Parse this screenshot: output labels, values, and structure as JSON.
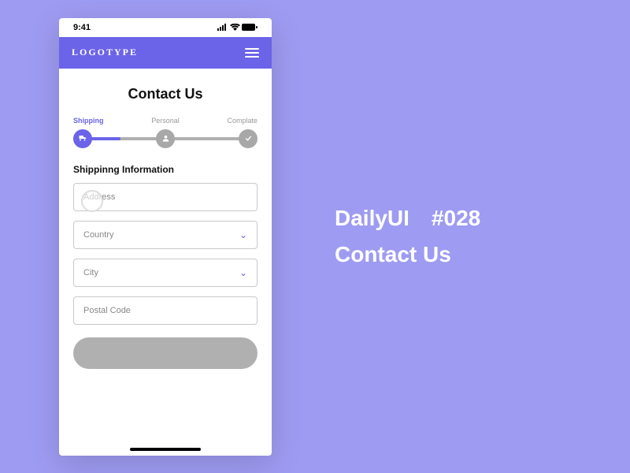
{
  "status": {
    "time": "9:41"
  },
  "header": {
    "logo": "LOGOTYPE"
  },
  "page": {
    "title": "Contact Us"
  },
  "stepper": {
    "steps": [
      {
        "label": "Shipping"
      },
      {
        "label": "Personal"
      },
      {
        "label": "Complate"
      }
    ]
  },
  "section": {
    "title": "Shippinng Information"
  },
  "form": {
    "address": {
      "placeholder": "Address"
    },
    "country": {
      "placeholder": "Country"
    },
    "city": {
      "placeholder": "City"
    },
    "postal": {
      "placeholder": "Postal Code"
    }
  },
  "button": {
    "next": ""
  },
  "side": {
    "line1": "DailyUI #028",
    "line2": "Contact Us"
  }
}
